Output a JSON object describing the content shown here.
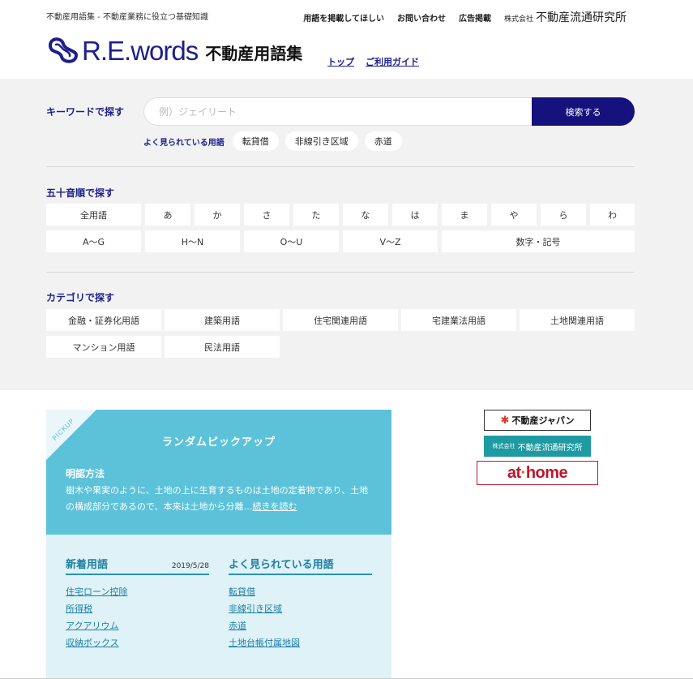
{
  "header": {
    "tagline": "不動産用語集 - 不動産業務に役立つ基礎知識",
    "links": [
      "用語を掲載してほしい",
      "お問い合わせ",
      "広告掲載"
    ],
    "company_prefix": "株式会社",
    "company_name": "不動産流通研究所",
    "logo_text": "R.E.",
    "logo_words": "words",
    "logo_subtitle": "不動産用語集",
    "nav": [
      "トップ",
      "ご利用ガイド"
    ]
  },
  "search": {
    "label": "キーワードで探す",
    "placeholder": "例）ジェイリート",
    "button_label": "検索する",
    "popular_label": "よく見られている用語",
    "popular_terms": [
      "転貸借",
      "非線引き区域",
      "赤道"
    ]
  },
  "gojuon": {
    "title": "五十音順で探す",
    "row1": [
      "全用語",
      "あ",
      "か",
      "さ",
      "た",
      "な",
      "は",
      "ま",
      "や",
      "ら",
      "わ"
    ],
    "row2": [
      "A～G",
      "H～N",
      "O～U",
      "V～Z",
      "数字・記号"
    ]
  },
  "category": {
    "title": "カテゴリで探す",
    "items": [
      "金融・証券化用語",
      "建築用語",
      "住宅関連用語",
      "宅建業法用語",
      "土地関連用語",
      "マンション用語",
      "民法用語"
    ]
  },
  "pickup": {
    "corner_label": "PICKUP",
    "heading": "ランダムピックアップ",
    "term": "明認方法",
    "description": "樹木や果実のように、土地の上に生育するものは土地の定着物であり、土地の構成部分であるので、本来は土地から分離…",
    "read_more": "続きを読む"
  },
  "new_terms": {
    "title": "新着用語",
    "date": "2019/5/28",
    "items": [
      "住宅ローン控除",
      "所得税",
      "アクアリウム",
      "収納ボックス"
    ]
  },
  "popular_terms": {
    "title": "よく見られている用語",
    "items": [
      "転貸借",
      "非線引き区域",
      "赤道",
      "土地台帳付属地図"
    ]
  },
  "banners": {
    "b1": "不動産ジャパン",
    "b2_prefix": "株式会社",
    "b2": "不動産流通研究所",
    "b3_a": "at",
    "b3_b": "home"
  },
  "colors": {
    "brand_navy": "#1d1f8c",
    "search_button": "#15127e",
    "pickup_bg": "#5cc2da",
    "lists_bg": "#def2f8",
    "link_blue": "#1d7fa3",
    "athome_red": "#c0162c"
  }
}
